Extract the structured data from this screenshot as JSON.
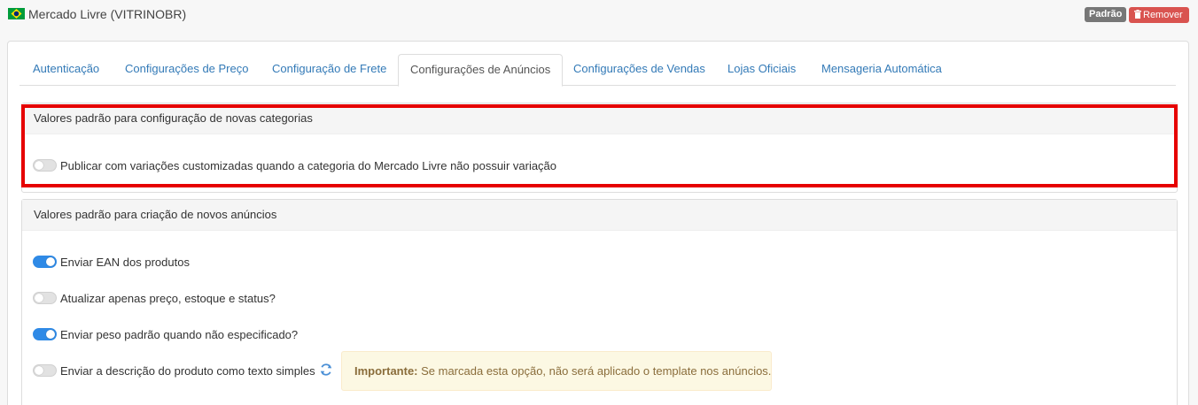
{
  "header": {
    "flag_icon": "brazil-flag-icon",
    "store_title": "Mercado Livre (VITRINOBR)",
    "default_badge": "Padrão",
    "remove_label": "Remover",
    "remove_icon": "trash-icon"
  },
  "tabs": [
    {
      "label": "Autenticação",
      "active": false
    },
    {
      "label": "Configurações de Preço",
      "active": false
    },
    {
      "label": "Configuração de Frete",
      "active": false
    },
    {
      "label": "Configurações de Anúncios",
      "active": true
    },
    {
      "label": "Configurações de Vendas",
      "active": false
    },
    {
      "label": "Lojas Oficiais",
      "active": false
    },
    {
      "label": "Mensageria Automática",
      "active": false
    }
  ],
  "categories_section": {
    "title": "Valores padrão para configuração de novas categorias",
    "options": [
      {
        "label": "Publicar com variações customizadas quando a categoria do Mercado Livre não possuir variação",
        "enabled": false
      }
    ]
  },
  "listings_section": {
    "title": "Valores padrão para criação de novos anúncios",
    "options": [
      {
        "label": "Enviar EAN dos produtos",
        "enabled": true
      },
      {
        "label": "Atualizar apenas preço, estoque e status?",
        "enabled": false
      },
      {
        "label": "Enviar peso padrão quando não especificado?",
        "enabled": true
      },
      {
        "label": "Enviar a descrição do produto como texto simples",
        "enabled": false
      }
    ],
    "refresh_icon": "refresh-icon",
    "alert": {
      "strong": "Importante:",
      "text": " Se marcada esta opção, não será aplicado o template nos anúncios."
    }
  },
  "colors": {
    "accent": "#2f8ae6",
    "link": "#337ab7",
    "danger": "#d9534f",
    "highlight": "#e60000"
  }
}
